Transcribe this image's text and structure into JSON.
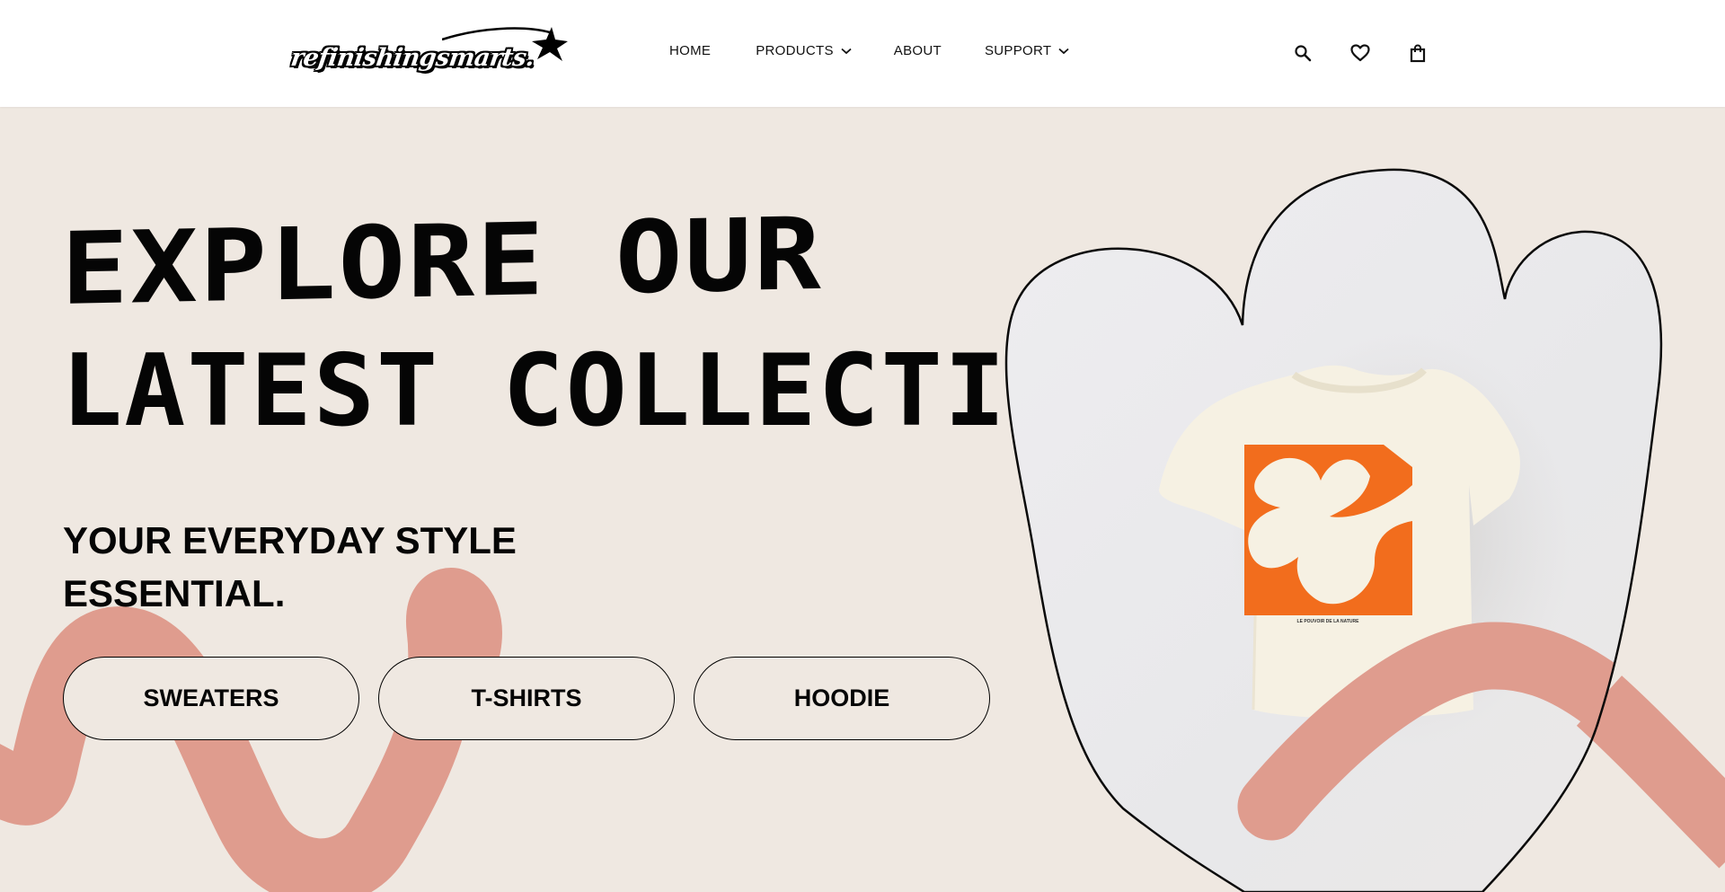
{
  "brand": {
    "logo_text": "refinishingsmarts."
  },
  "nav": {
    "items": [
      {
        "label": "HOME"
      },
      {
        "label": "PRODUCTS"
      },
      {
        "label": "ABOUT"
      },
      {
        "label": "SUPPORT"
      }
    ]
  },
  "header_icons": [
    "search-icon",
    "heart-icon",
    "shopping-bag-icon"
  ],
  "hero": {
    "title_line1": "EXPLORE OUR",
    "title_line2": "LATEST COLLECTION",
    "subtitle": "YOUR EVERYDAY STYLE ESSENTIAL.",
    "categories": [
      {
        "label": "SWEATERS"
      },
      {
        "label": "T-SHIRTS"
      },
      {
        "label": "HOODIE"
      }
    ],
    "product_print_text": "LE POUVOIR DE LA NATURE"
  },
  "colors": {
    "background": "#efe8e1",
    "header": "#ffffff",
    "accent_pink": "#df9c8e",
    "print_orange": "#f26d1d",
    "text": "#050505"
  }
}
